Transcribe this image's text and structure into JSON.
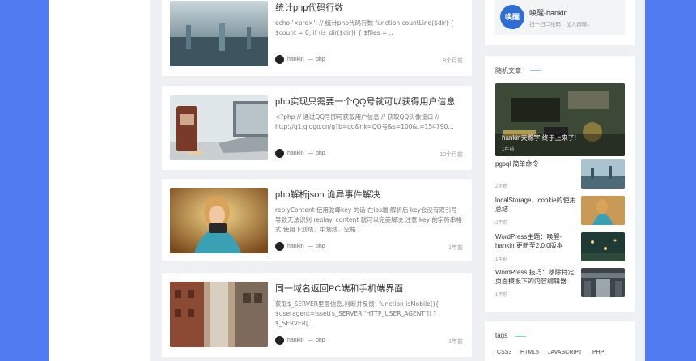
{
  "posts": [
    {
      "title": "统计php代码行数",
      "excerpt": "echo '<pre>'; // 统计php代码行数 function countLine($dir) { $count = 0; if (is_dir($dir)) { $files =…",
      "author": "hankin",
      "sep": "—",
      "category": "php",
      "time": "8个月前"
    },
    {
      "title": "php实现只需要一个QQ号就可以获得用户信息",
      "excerpt": "<?php // 通过QQ号即可获取用户信息 // 获取QQ头像接口 // http://q1.qlogo.cn/g?b=qq&nk=QQ号&s=100&t=154790…",
      "author": "hankin",
      "sep": "—",
      "category": "php",
      "time": "10个月前"
    },
    {
      "title": "php解析json 诡异事件解决",
      "excerpt": "replyContent 使用驼峰key 的话 在ios端 解析后 key会没有双引号 导致无法识别 replay_content 就可以完美解决 注意 key 的字符串格式 使用下划线、中划线、空格…",
      "author": "hankin",
      "sep": "—",
      "category": "php",
      "time": "1年前"
    },
    {
      "title": "同一域名返回PC端和手机端界面",
      "excerpt": "获取$_SERVER里面信息,判断并反馈! function isMobile(){ $useragent=isset($_SERVER['HTTP_USER_AGENT']) ? $_SERVER[…",
      "author": "hankin",
      "sep": "—",
      "category": "php",
      "time": "1年前"
    }
  ],
  "profile": {
    "logo_text": "唤醒",
    "name": "唤醒-hankin",
    "sub": "扫一扫二维码，加入群聊。"
  },
  "random": {
    "heading": "随机文章",
    "featured_title": "hankin天赐字 终于上来了!",
    "featured_date": "1年前",
    "items": [
      {
        "title": "pgsql 简单命令",
        "date": "2年前"
      },
      {
        "title": "localStorage、cookie的使用总结",
        "date": "2年前"
      },
      {
        "title": "WordPress主题：唤醒-hankin 更新至2.0.0版本",
        "date": "1年前"
      },
      {
        "title": "WordPress 技巧：移除特定页面模板下的内容编辑器",
        "date": "1年前"
      }
    ]
  },
  "tags": {
    "heading": "tags",
    "items": [
      "CSS3",
      "HTML5",
      "JAVASCRIPT",
      "PHP"
    ]
  },
  "colors": {
    "background": "#4f7cf0",
    "page": "#eef0f4",
    "accent_line": "#7ed6c4"
  }
}
